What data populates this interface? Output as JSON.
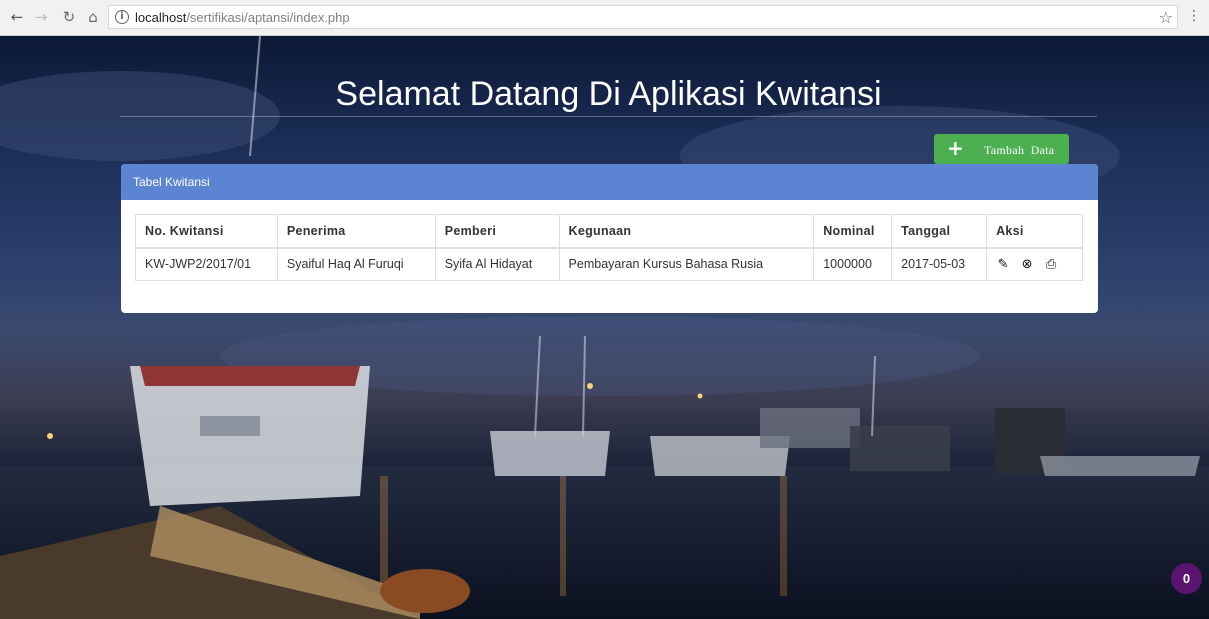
{
  "browser": {
    "url_host": "localhost",
    "url_path": "/sertifikasi/aptansi/index.php",
    "icons": {
      "back": "back-arrow-icon",
      "forward": "forward-arrow-icon",
      "reload": "reload-icon",
      "home": "home-icon",
      "info": "info-icon",
      "bookmark": "star-icon",
      "menu": "menu-dots-icon"
    }
  },
  "page": {
    "title": "Selamat Datang Di Aplikasi Kwitansi",
    "add_button_label": "Tambah Data",
    "add_button_color": "#4caf50",
    "panel_title": "Tabel Kwitansi",
    "panel_heading_color": "#5b84d3"
  },
  "table": {
    "headers": [
      "No. Kwitansi",
      "Penerima",
      "Pemberi",
      "Kegunaan",
      "Nominal",
      "Tanggal",
      "Aksi"
    ],
    "rows": [
      {
        "no_kwitansi": "KW-JWP2/2017/01",
        "penerima": "Syaiful Haq Al Furuqi",
        "pemberi": "Syifa Al Hidayat",
        "kegunaan": "Pembayaran Kursus Bahasa Rusia",
        "nominal": "1000000",
        "tanggal": "2017-05-03",
        "actions": [
          "edit-pencil-icon",
          "delete-remove-icon",
          "print-icon"
        ]
      }
    ]
  },
  "notification_badge": {
    "count": "0",
    "color": "#5a1470"
  }
}
